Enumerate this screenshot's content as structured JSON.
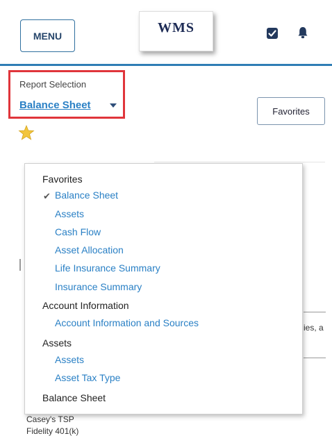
{
  "header": {
    "menu_label": "MENU",
    "logo_text": "WMS",
    "tasks_icon": "checkbox-icon",
    "notifications_icon": "bell-icon",
    "accent_color": "#2f7db5"
  },
  "report_selection": {
    "label": "Report Selection",
    "selected": "Balance Sheet",
    "favorite_icon": "star-icon",
    "favorites_button": "Favorites",
    "highlight_color": "#e0353b"
  },
  "dropdown": {
    "groups": [
      {
        "heading": "Favorites",
        "items": [
          "Balance Sheet",
          "Assets",
          "Cash Flow",
          "Asset Allocation",
          "Life Insurance Summary",
          "Insurance Summary"
        ],
        "checked_item": "Balance Sheet"
      },
      {
        "heading": "Account Information",
        "items": [
          "Account Information and Sources"
        ]
      },
      {
        "heading": "Assets",
        "items": [
          "Assets",
          "Asset Tax Type"
        ]
      },
      {
        "heading": "Balance Sheet",
        "items": []
      }
    ],
    "check_mark": "✔"
  },
  "background": {
    "partial_text": "ies, a",
    "rows": [
      "Casey's TSP",
      "Fidelity 401(k)"
    ]
  }
}
